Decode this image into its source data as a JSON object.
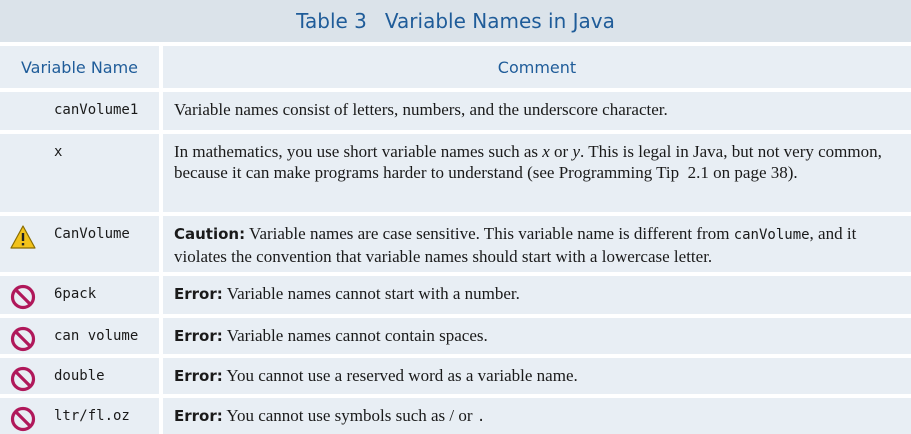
{
  "title": {
    "number": "Table 3",
    "text": "Variable Names in Java"
  },
  "header": {
    "col1": "Variable Name",
    "col2": "Comment"
  },
  "rows": [
    {
      "icon": "none",
      "name": "canVolume1",
      "comment": "Variable names consist of letters, numbers, and the underscore character."
    },
    {
      "icon": "none",
      "name": "x",
      "comment_a": "In mathematics, you use short variable names such as ",
      "var_x": "x",
      "or": " or ",
      "var_y": "y",
      "comment_b": ". This is legal in Java, but not very common, because it can make programs harder to understand (see Programming Tip  2.1 on page 38)."
    },
    {
      "icon": "warning-icon",
      "name": "CanVolume",
      "lead": "Caution:",
      "comment_a": " Variable names are case sensitive. This variable name is different from ",
      "code": "canVolume",
      "comment_b": ", and it violates the convention that variable names should start with a lowercase letter."
    },
    {
      "icon": "prohibited-icon",
      "name": "6pack",
      "lead": "Error:",
      "comment": " Variable names cannot start with a number."
    },
    {
      "icon": "prohibited-icon",
      "name": "can volume",
      "lead": "Error:",
      "comment": " Variable names cannot contain spaces."
    },
    {
      "icon": "prohibited-icon",
      "name": "double",
      "lead": "Error:",
      "comment": " You cannot use a reserved word as a variable name."
    },
    {
      "icon": "prohibited-icon",
      "name": "ltr/fl.oz",
      "lead": "Error:",
      "comment_a": " You cannot use symbols such as / or",
      "dot": "."
    }
  ],
  "colors": {
    "title_bg": "#dbe3ea",
    "cell_bg": "#e8eef4",
    "heading": "#1f5c99",
    "error": "#b0185a",
    "warning": "#f2c21a"
  }
}
